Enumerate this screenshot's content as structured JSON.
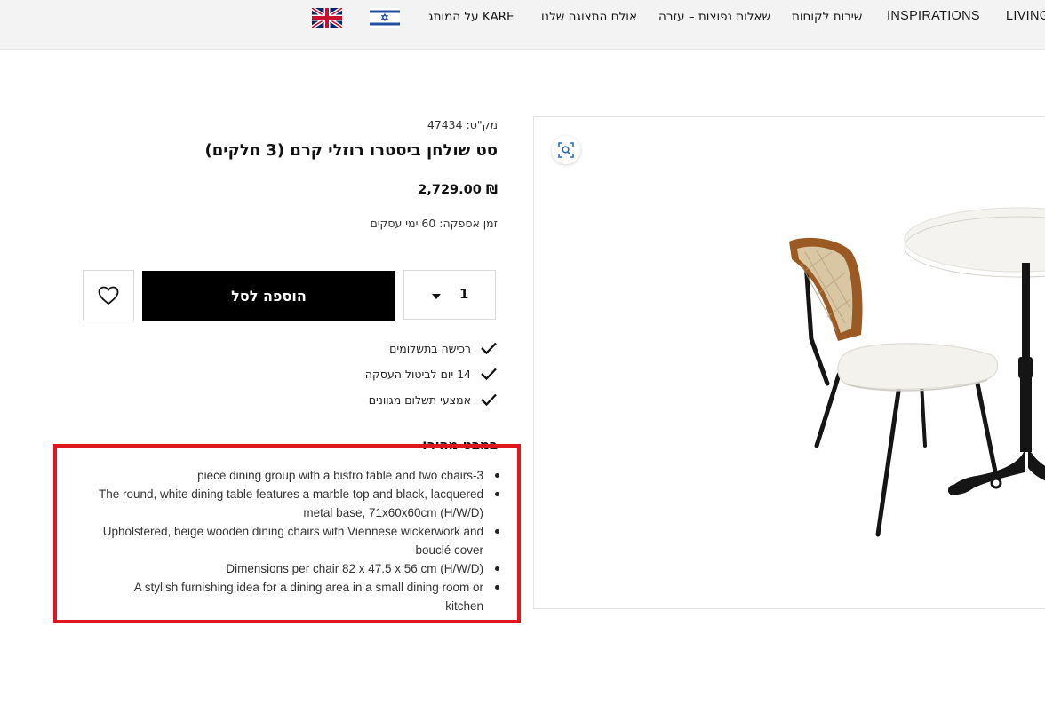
{
  "nav": {
    "items": [
      {
        "label": "LIVING"
      },
      {
        "label": "INSPIRATIONS"
      },
      {
        "label": "שירות לקוחות"
      },
      {
        "label": "שאלות נפוצות – עזרה"
      },
      {
        "label": "אולם התצוגה שלנו"
      },
      {
        "label": "על המותג KARE"
      }
    ],
    "flags": [
      {
        "name": "israel-flag-icon",
        "colors": [
          "#ffffff",
          "#1f4ea3"
        ]
      },
      {
        "name": "uk-flag-icon",
        "colors": [
          "#012169",
          "#ffffff",
          "#c8102e"
        ]
      }
    ]
  },
  "product": {
    "sku": "מק\"ט: 47434",
    "title": "סט שולחן ביסטרו רוזלי קרם (3 חלקים)",
    "price": "₪ 2,729.00",
    "delivery_label": "זמן אספקה:",
    "delivery_value": "60 ימי עסקים"
  },
  "purchase": {
    "quantity": "1",
    "add_to_cart_label": "הוספה לסל",
    "wishlist_icon": "heart-icon"
  },
  "features": [
    "רכישה בתשלומים",
    "14 יום לביטול העסקה",
    "אמצעי תשלום מגוונים"
  ],
  "description": {
    "heading": "במבט מהיר:",
    "bullets": [
      "piece dining group with a bistro table and two chairs-3",
      "The round, white dining table features a marble top and black, lacquered metal base, 71x60x60cm (H/W/D)",
      "Upholstered, beige wooden dining chairs with Viennese wickerwork and bouclé cover",
      "Dimensions per chair 82 x 47.5 x 56 cm (H/W/D)",
      "A stylish furnishing idea for a dining area in a small dining room or kitchen"
    ]
  },
  "image": {
    "zoom_icon": "zoom-scan-icon"
  },
  "colors": {
    "accent_black": "#000000",
    "highlight_red": "#e0161e",
    "nav_background": "#f3f3f3"
  }
}
